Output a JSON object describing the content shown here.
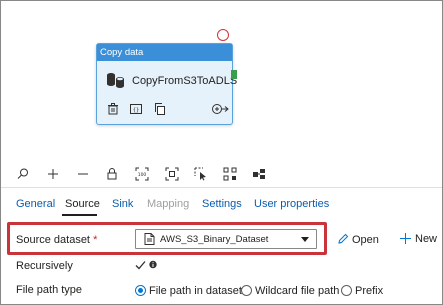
{
  "activity": {
    "header": "Copy data",
    "name": "CopyFromS3ToADLS"
  },
  "tabs": [
    {
      "label": "General"
    },
    {
      "label": "Source"
    },
    {
      "label": "Sink"
    },
    {
      "label": "Mapping"
    },
    {
      "label": "Settings"
    },
    {
      "label": "User properties"
    }
  ],
  "source": {
    "dataset_label": "Source dataset",
    "required_mark": "*",
    "dataset_value": "AWS_S3_Binary_Dataset",
    "open_label": "Open",
    "new_label": "New",
    "recursively_label": "Recursively",
    "file_path_type_label": "File path type",
    "file_path_options": [
      {
        "label": "File path in dataset",
        "selected": true
      },
      {
        "label": "Wildcard file path",
        "selected": false
      },
      {
        "label": "Prefix",
        "selected": false
      }
    ]
  },
  "toolbar_icons": [
    "search-icon",
    "zoom-in-icon",
    "zoom-out-icon",
    "lock-icon",
    "zoom-100-icon",
    "fit-to-window-icon",
    "select-icon",
    "auto-align-icon",
    "layers-icon"
  ],
  "colors": {
    "accent": "#0078d4",
    "activity_header": "#3b8ed8",
    "highlight": "#c8343a",
    "port": "#3a9d4d"
  }
}
